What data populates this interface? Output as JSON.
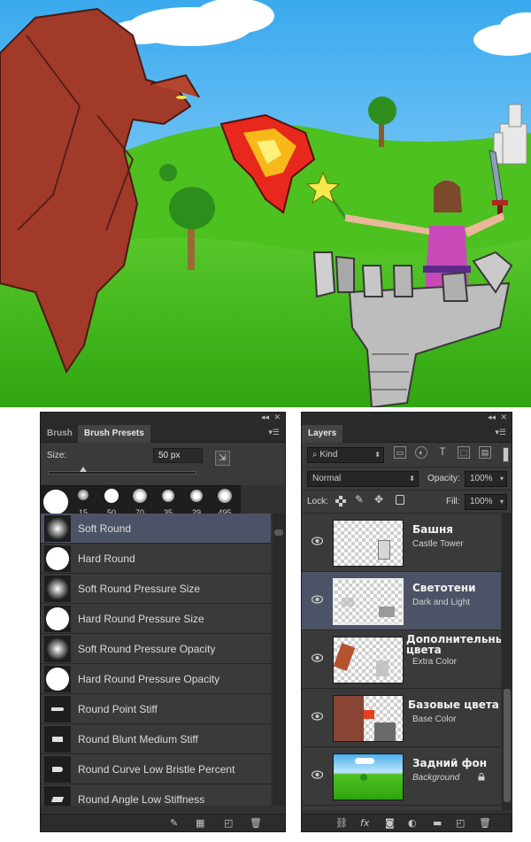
{
  "brush_panel": {
    "tabs": [
      "Brush",
      "Brush Presets"
    ],
    "size_label": "Size:",
    "size_value": "50 px",
    "thumb_sizes": [
      "15",
      "50",
      "70",
      "35",
      "29",
      "495"
    ],
    "presets": [
      {
        "name": "Soft Round",
        "icon": "soft-round-icon"
      },
      {
        "name": "Hard Round",
        "icon": "hard-round-icon"
      },
      {
        "name": "Soft Round Pressure Size",
        "icon": "soft-round-icon"
      },
      {
        "name": "Hard Round Pressure Size",
        "icon": "hard-round-icon"
      },
      {
        "name": "Soft Round Pressure Opacity",
        "icon": "soft-round-icon"
      },
      {
        "name": "Hard Round Pressure Opacity",
        "icon": "hard-round-icon"
      },
      {
        "name": "Round Point Stiff",
        "icon": "bristle-icon"
      },
      {
        "name": "Round Blunt Medium Stiff",
        "icon": "bristle-icon"
      },
      {
        "name": "Round Curve Low Bristle Percent",
        "icon": "bristle-icon"
      },
      {
        "name": "Round Angle Low Stiffness",
        "icon": "bristle-icon"
      }
    ],
    "selected_index": 0
  },
  "layers_panel": {
    "tab": "Layers",
    "kind_filter": "Kind",
    "blend_mode": "Normal",
    "opacity_label": "Opacity:",
    "opacity_value": "100%",
    "lock_label": "Lock:",
    "fill_label": "Fill:",
    "fill_value": "100%",
    "layers": [
      {
        "name": "Башня",
        "sub": "Castle Tower"
      },
      {
        "name": "Светотени",
        "sub": "Dark and Light"
      },
      {
        "name": "Дополнительные цвета",
        "sub": "Extra Color"
      },
      {
        "name": "Базовые цвета",
        "sub": "Base Color"
      },
      {
        "name": "Задний фон",
        "sub": "Background"
      }
    ],
    "selected_index": 1
  },
  "colors": {
    "panel_bg": "#323232",
    "selection": "#4d5366",
    "sky": "#6cc4f0",
    "grass": "#3fb81c"
  }
}
